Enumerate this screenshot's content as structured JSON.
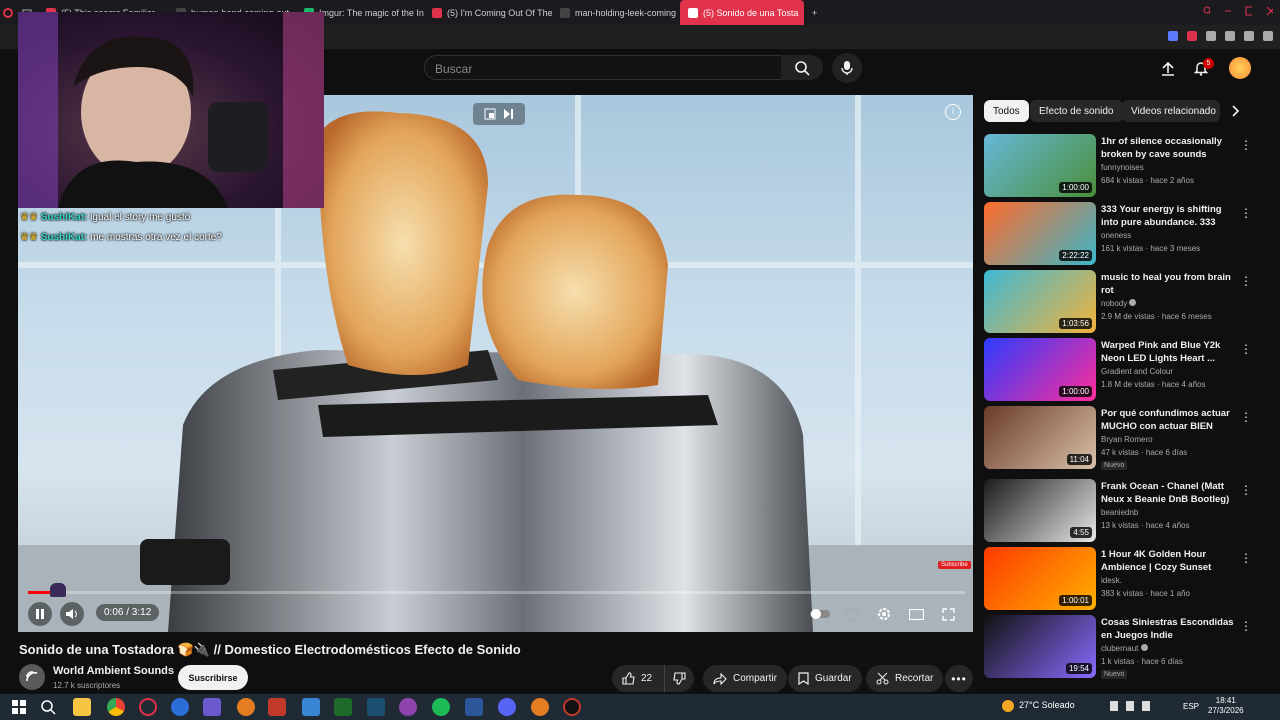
{
  "browser": {
    "tabs": [
      {
        "label": "(5) This seems Familiar",
        "color": "#e0324b"
      },
      {
        "label": "human-hand-coming-out",
        "color": "#444"
      },
      {
        "label": "Imgur: The magic of the In",
        "color": "#1bb76e"
      },
      {
        "label": "(5) I'm Coming Out Of The",
        "color": "#e0324b"
      },
      {
        "label": "man-holding-leek-coming",
        "color": "#444"
      },
      {
        "label": "(5) Sonido de una Tosta",
        "color": "#ffffff"
      }
    ],
    "new_tab": "+"
  },
  "header": {
    "search_placeholder": "Buscar",
    "notification_count": "5"
  },
  "player": {
    "chat": [
      {
        "user": "SushiKat:",
        "msg": "igual el story me gustó"
      },
      {
        "user": "SushiKat:",
        "msg": "me mostras otra vez el corte?"
      }
    ],
    "time": "0:06 / 3:12",
    "progress": 0.031,
    "subscribe_watermark": "Subscribe"
  },
  "video": {
    "title": "Sonido de una Tostadora 🍞🔌 // Domestico Electrodomésticos Efecto de Sonido",
    "channel": "World Ambient Sounds",
    "subscribers": "12.7 k suscriptores",
    "subscribe_label": "Suscribirse",
    "likes": "22",
    "share_label": "Compartir",
    "save_label": "Guardar",
    "clip_label": "Recortar"
  },
  "sidebar": {
    "chips": [
      "Todos",
      "Efecto de sonido",
      "Videos relacionado"
    ],
    "recommendations": [
      {
        "title": "1hr of silence occasionally broken by cave sounds",
        "channel": "funnynoises",
        "meta": "684 k vistas · hace 2 años",
        "duration": "1:00:00",
        "colors": [
          "#67b8d8",
          "#4a8f3a"
        ],
        "verified": false,
        "badge": ""
      },
      {
        "title": "333 Your energy is shifting into pure abundance. 333",
        "channel": "oneness",
        "meta": "161 k vistas · hace 3 meses",
        "duration": "2:22:22",
        "colors": [
          "#ff6a2a",
          "#3bb7c9"
        ],
        "verified": false,
        "badge": ""
      },
      {
        "title": "music to heal you from brain rot",
        "channel": "nobody",
        "meta": "2.9 M de vistas · hace 6 meses",
        "duration": "1:03:56",
        "colors": [
          "#3db8d6",
          "#f3b23a"
        ],
        "verified": true,
        "badge": ""
      },
      {
        "title": "Warped Pink and Blue Y2k Neon LED Lights Heart ...",
        "channel": "Gradient and Colour",
        "meta": "1.8 M de vistas · hace 4 años",
        "duration": "1:00:00",
        "colors": [
          "#2c3cff",
          "#ff2d9a"
        ],
        "verified": false,
        "badge": ""
      },
      {
        "title": "Por qué confundimos actuar MUCHO con actuar BIEN",
        "channel": "Bryan Romero",
        "meta": "47 k vistas · hace 6 días",
        "duration": "11:04",
        "colors": [
          "#6a3a2a",
          "#d9c1a8"
        ],
        "verified": false,
        "badge": "Nuevo"
      },
      {
        "title": "Frank Ocean - Chanel (Matt Neux x Beanie DnB Bootleg) ...",
        "channel": "beaniednb",
        "meta": "13 k vistas · hace 4 años",
        "duration": "4:55",
        "colors": [
          "#1a1a1a",
          "#e8e8e8"
        ],
        "verified": false,
        "badge": ""
      },
      {
        "title": "1 Hour 4K Golden Hour Ambience | Cozy Sunset Lamp...",
        "channel": "idesk.",
        "meta": "383 k vistas · hace 1 año",
        "duration": "1:00:01",
        "colors": [
          "#ff3a00",
          "#ffb000"
        ],
        "verified": false,
        "badge": ""
      },
      {
        "title": "Cosas Siniestras Escondidas en Juegos Indie",
        "channel": "clubernaut",
        "meta": "1 k vistas · hace 6 días",
        "duration": "19:54",
        "colors": [
          "#111",
          "#8a6aff"
        ],
        "verified": true,
        "badge": "Nuevo"
      }
    ]
  },
  "taskbar": {
    "weather": "27°C  Soleado",
    "lang": "ESP",
    "time": "18:41",
    "date": "27/3/2026"
  },
  "colors": {
    "accent": "#ff0000",
    "bg": "#0f0f0f",
    "tab_active": "#e0324b"
  }
}
